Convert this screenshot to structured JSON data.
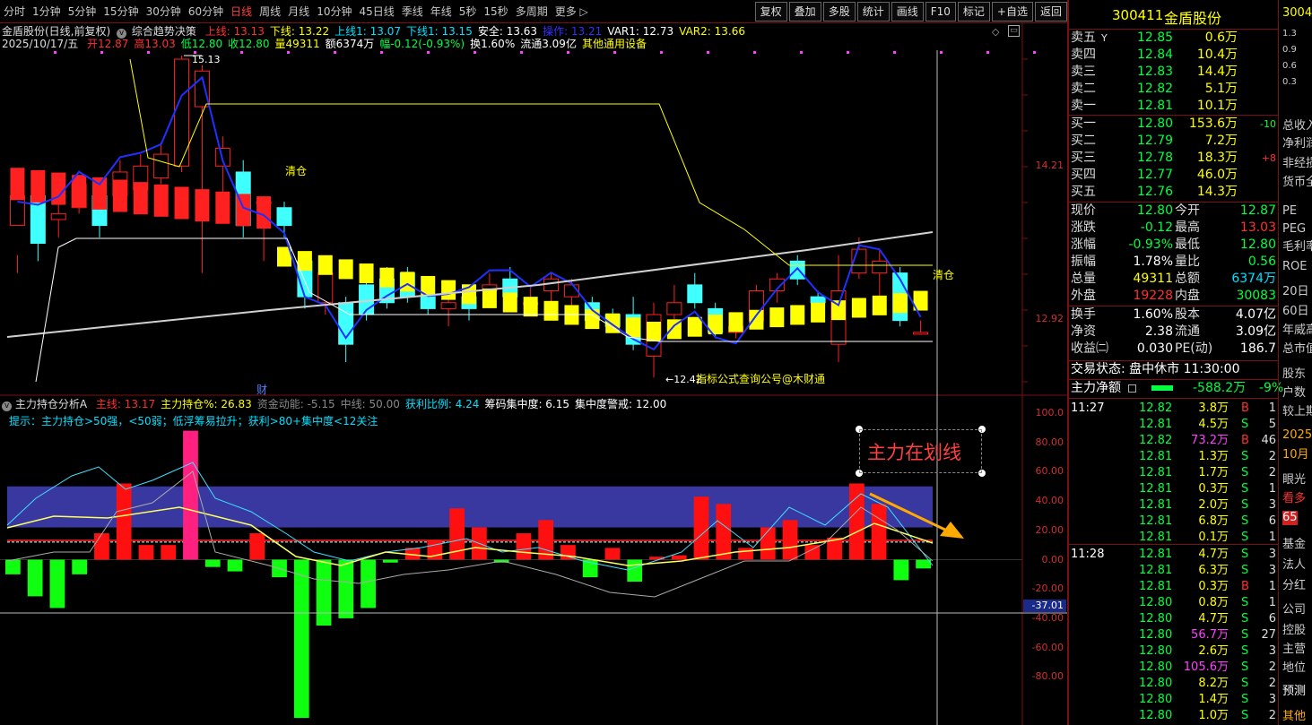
{
  "toolbar": {
    "periods": [
      "分时",
      "1分钟",
      "5分钟",
      "15分钟",
      "30分钟",
      "60分钟",
      "日线",
      "周线",
      "月线",
      "10分钟",
      "45日线",
      "季线",
      "年线",
      "5秒",
      "15秒",
      "多周期",
      "更多 ▷"
    ],
    "active_period": "日线",
    "tools": [
      "复权",
      "叠加",
      "多股",
      "统计",
      "画线",
      "F10",
      "标记",
      "+自选",
      "返回"
    ]
  },
  "chart": {
    "title": "金盾股份(日线,前复权)",
    "indicator": "综合趋势决策",
    "params": [
      {
        "t": "上线: 13.13",
        "c": "#ff3030"
      },
      {
        "t": "下线: 13.22",
        "c": "#ffff00"
      },
      {
        "t": "上线1: 13.07",
        "c": "#00e0ff"
      },
      {
        "t": "下线1: 13.15",
        "c": "#00e0ff"
      },
      {
        "t": "安全: 13.63",
        "c": "#ffffff"
      },
      {
        "t": "操作: 13.21",
        "c": "#3030ff"
      },
      {
        "t": "VAR1: 12.73",
        "c": "#ffffff"
      },
      {
        "t": "VAR2: 13.66",
        "c": "#ffff00"
      }
    ],
    "date": "2025/10/17/五",
    "ohlc": [
      {
        "t": "开12.87",
        "c": "#ff3030"
      },
      {
        "t": "高13.03",
        "c": "#ff3030"
      },
      {
        "t": "低12.80",
        "c": "#00ff40"
      },
      {
        "t": "收12.80",
        "c": "#00ff40"
      },
      {
        "t": "量49311",
        "c": "#ffff00"
      },
      {
        "t": "额6374万",
        "c": "#ffffff"
      },
      {
        "t": "幅-0.12(-0.93%)",
        "c": "#00ff40"
      },
      {
        "t": "换1.60%",
        "c": "#ffffff"
      },
      {
        "t": "流通3.09亿",
        "c": "#ffffff"
      },
      {
        "t": "其他通用设备",
        "c": "#ffff00"
      }
    ],
    "high_label": "15.13",
    "low_label": "12.42",
    "promo": "指标公式查询公号@木财通",
    "clear1": "清仓",
    "clear2": "清仓",
    "cai": "财",
    "y_labels": [
      "14.21",
      "12.92"
    ]
  },
  "sub": {
    "name": "主力持仓分析A",
    "params": [
      {
        "t": "主线: 13.17",
        "c": "#ff3030"
      },
      {
        "t": "主力持仓%: 26.83",
        "c": "#ffff00"
      },
      {
        "t": "资金动能: -5.15",
        "c": "#888888"
      },
      {
        "t": "中线: 50.00",
        "c": "#888888"
      },
      {
        "t": "获利比例: 4.24",
        "c": "#00e0ff"
      },
      {
        "t": "筹码集中度: 6.15",
        "c": "#ffffff"
      },
      {
        "t": "集中度警戒: 12.00",
        "c": "#ffffff"
      }
    ],
    "hint": "提示：主力持仓>50强，<50弱；低浮筹易拉升；获利>80+集中度<12关注",
    "drawn_text": "主力在划线",
    "y_labels": [
      "100.0",
      "80.00",
      "60.00",
      "40.00",
      "20.00",
      "0.00",
      "-20.00",
      "-40.00",
      "-60.00",
      "-80.00"
    ],
    "cursor_value": "-37.01"
  },
  "quote": {
    "code": "300411",
    "name": "金盾股份",
    "asks": [
      {
        "label": "卖五",
        "flag": "Y",
        "price": "12.85",
        "vol": "0.6万"
      },
      {
        "label": "卖四",
        "price": "12.84",
        "vol": "10.4万"
      },
      {
        "label": "卖三",
        "price": "12.83",
        "vol": "14.4万"
      },
      {
        "label": "卖二",
        "price": "12.82",
        "vol": "5.1万"
      },
      {
        "label": "卖一",
        "price": "12.81",
        "vol": "10.1万"
      }
    ],
    "bids": [
      {
        "label": "买一",
        "price": "12.80",
        "vol": "153.6万",
        "chg": "-10",
        "chgc": "#00ff40"
      },
      {
        "label": "买二",
        "price": "12.79",
        "vol": "7.2万",
        "chg": "",
        "chgc": "#00ff40"
      },
      {
        "label": "买三",
        "price": "12.78",
        "vol": "18.3万",
        "chg": "+8",
        "chgc": "#ff3030"
      },
      {
        "label": "买四",
        "price": "12.77",
        "vol": "46.0万",
        "chg": "",
        "chgc": "#00ff40"
      },
      {
        "label": "买五",
        "price": "12.76",
        "vol": "14.3万",
        "chg": "",
        "chgc": "#00ff40"
      }
    ],
    "stats": [
      {
        "l1": "现价",
        "v1": "12.80",
        "c1": "#00ff40",
        "l2": "今开",
        "v2": "12.87",
        "c2": "#00ff40"
      },
      {
        "l1": "涨跌",
        "v1": "-0.12",
        "c1": "#00ff40",
        "l2": "最高",
        "v2": "13.03",
        "c2": "#ff3030"
      },
      {
        "l1": "涨幅",
        "v1": "-0.93%",
        "c1": "#00ff40",
        "l2": "最低",
        "v2": "12.80",
        "c2": "#00ff40"
      },
      {
        "l1": "振幅",
        "v1": "1.78%",
        "c1": "#ffffff",
        "l2": "量比",
        "v2": "0.56",
        "c2": "#00ff40"
      },
      {
        "l1": "总量",
        "v1": "49311",
        "c1": "#ffff00",
        "l2": "总额",
        "v2": "6374万",
        "c2": "#00e0ff"
      },
      {
        "l1": "外盘",
        "v1": "19228",
        "c1": "#ff3030",
        "l2": "内盘",
        "v2": "30083",
        "c2": "#00ff40"
      }
    ],
    "stats2": [
      {
        "l1": "换手",
        "v1": "1.60%",
        "l2": "股本",
        "v2": "4.07亿"
      },
      {
        "l1": "净资",
        "v1": "2.38",
        "l2": "流通",
        "v2": "3.09亿"
      },
      {
        "l1": "收益㈡",
        "v1": "0.030",
        "l2": "PE(动)",
        "v2": "186.7"
      }
    ],
    "trade_status": "交易状态: 盘中休市 11:30:00",
    "net_label": "主力净额",
    "net_value": "-588.2万",
    "net_pct": "-9%",
    "ticks": [
      {
        "time": "11:27",
        "price": "12.82",
        "vol": "3.8万",
        "bs": "B",
        "n": "1"
      },
      {
        "time": "",
        "price": "12.81",
        "vol": "4.5万",
        "bs": "S",
        "n": "5"
      },
      {
        "time": "",
        "price": "12.82",
        "vol": "73.2万",
        "bs": "B",
        "n": "46"
      },
      {
        "time": "",
        "price": "12.81",
        "vol": "1.3万",
        "bs": "S",
        "n": "2"
      },
      {
        "time": "",
        "price": "12.81",
        "vol": "1.7万",
        "bs": "S",
        "n": "2"
      },
      {
        "time": "",
        "price": "12.81",
        "vol": "0.3万",
        "bs": "S",
        "n": "1"
      },
      {
        "time": "",
        "price": "12.81",
        "vol": "2.0万",
        "bs": "S",
        "n": "3"
      },
      {
        "time": "",
        "price": "12.81",
        "vol": "6.8万",
        "bs": "S",
        "n": "6"
      },
      {
        "time": "",
        "price": "12.81",
        "vol": "0.1万",
        "bs": "S",
        "n": "1"
      },
      {
        "time": "11:28",
        "price": "12.81",
        "vol": "4.7万",
        "bs": "S",
        "n": "3"
      },
      {
        "time": "",
        "price": "12.81",
        "vol": "6.3万",
        "bs": "S",
        "n": "3"
      },
      {
        "time": "",
        "price": "12.81",
        "vol": "0.3万",
        "bs": "B",
        "n": "1"
      },
      {
        "time": "",
        "price": "12.80",
        "vol": "0.8万",
        "bs": "S",
        "n": "1"
      },
      {
        "time": "",
        "price": "12.80",
        "vol": "4.7万",
        "bs": "S",
        "n": "6"
      },
      {
        "time": "",
        "price": "12.80",
        "vol": "56.7万",
        "bs": "S",
        "n": "27"
      },
      {
        "time": "",
        "price": "12.80",
        "vol": "2.6万",
        "bs": "S",
        "n": "3"
      },
      {
        "time": "",
        "price": "12.80",
        "vol": "105.6万",
        "bs": "S",
        "n": "2"
      },
      {
        "time": "",
        "price": "12.80",
        "vol": "8.2万",
        "bs": "S",
        "n": "2"
      },
      {
        "time": "",
        "price": "12.80",
        "vol": "1.4万",
        "bs": "S",
        "n": "3"
      },
      {
        "time": "",
        "price": "12.80",
        "vol": "1.0万",
        "bs": "S",
        "n": "2"
      }
    ]
  },
  "far": {
    "items": [
      "3004",
      "1.3",
      "0.9",
      "0.6",
      "0.3",
      "总收入",
      "净利润",
      "非经损",
      "货币全",
      "PE",
      "PEG",
      "毛利率",
      "ROE",
      "20日",
      "60日",
      "年威高",
      "总市值",
      "股东",
      "户数",
      "较上期",
      "2025",
      "10月",
      "眼光",
      "看多",
      "65",
      "基金",
      "法人",
      "分红",
      "公司",
      "控股",
      "主营",
      "地位",
      "预测",
      "其他"
    ]
  }
}
